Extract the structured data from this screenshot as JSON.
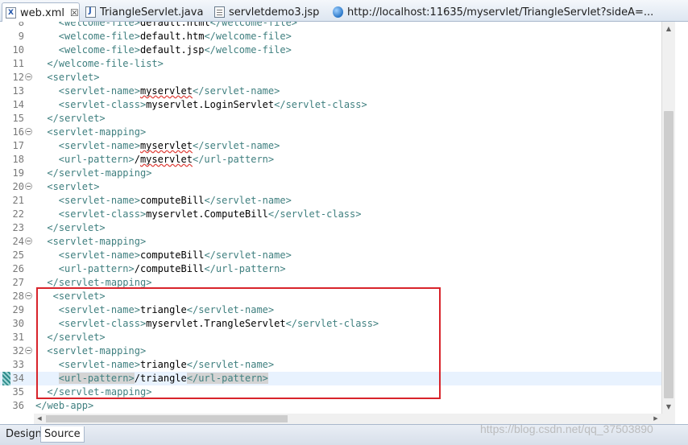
{
  "tabs": [
    {
      "label": "web.xml",
      "icon": "xml-file-icon",
      "active": true,
      "close": "☒"
    },
    {
      "label": "TriangleServlet.java",
      "icon": "java-file-icon",
      "active": false
    },
    {
      "label": "servletdemo3.jsp",
      "icon": "jsp-file-icon",
      "active": false
    },
    {
      "label": "http://localhost:11635/myservlet/TriangleServlet?sideA=...",
      "icon": "globe-icon",
      "active": false
    }
  ],
  "editor": {
    "lines": [
      {
        "n": "8",
        "fold": false,
        "indent": 4,
        "parts": [
          [
            "tag",
            "<welcome-file>"
          ],
          [
            "txt",
            "default.html"
          ],
          [
            "tag",
            "</welcome-file>"
          ]
        ]
      },
      {
        "n": "9",
        "fold": false,
        "indent": 4,
        "parts": [
          [
            "tag",
            "<welcome-file>"
          ],
          [
            "txt",
            "default.htm"
          ],
          [
            "tag",
            "</welcome-file>"
          ]
        ]
      },
      {
        "n": "10",
        "fold": false,
        "indent": 4,
        "parts": [
          [
            "tag",
            "<welcome-file>"
          ],
          [
            "txt",
            "default.jsp"
          ],
          [
            "tag",
            "</welcome-file>"
          ]
        ]
      },
      {
        "n": "11",
        "fold": false,
        "indent": 2,
        "parts": [
          [
            "tag",
            "</welcome-file-list>"
          ]
        ]
      },
      {
        "n": "12",
        "fold": true,
        "indent": 2,
        "parts": [
          [
            "tag",
            "<servlet>"
          ]
        ]
      },
      {
        "n": "13",
        "fold": false,
        "indent": 4,
        "parts": [
          [
            "tag",
            "<servlet-name>"
          ],
          [
            "err",
            "myservlet"
          ],
          [
            "tag",
            "</servlet-name>"
          ]
        ]
      },
      {
        "n": "14",
        "fold": false,
        "indent": 4,
        "parts": [
          [
            "tag",
            "<servlet-class>"
          ],
          [
            "txt",
            "myservlet.LoginServlet"
          ],
          [
            "tag",
            "</servlet-class>"
          ]
        ]
      },
      {
        "n": "15",
        "fold": false,
        "indent": 2,
        "parts": [
          [
            "tag",
            "</servlet>"
          ]
        ]
      },
      {
        "n": "16",
        "fold": true,
        "indent": 2,
        "parts": [
          [
            "tag",
            "<servlet-mapping>"
          ]
        ]
      },
      {
        "n": "17",
        "fold": false,
        "indent": 4,
        "parts": [
          [
            "tag",
            "<servlet-name>"
          ],
          [
            "err",
            "myservlet"
          ],
          [
            "tag",
            "</servlet-name>"
          ]
        ]
      },
      {
        "n": "18",
        "fold": false,
        "indent": 4,
        "parts": [
          [
            "tag",
            "<url-pattern>"
          ],
          [
            "txt",
            "/"
          ],
          [
            "err",
            "myservlet"
          ],
          [
            "tag",
            "</url-pattern>"
          ]
        ]
      },
      {
        "n": "19",
        "fold": false,
        "indent": 2,
        "parts": [
          [
            "tag",
            "</servlet-mapping>"
          ]
        ]
      },
      {
        "n": "20",
        "fold": true,
        "indent": 2,
        "parts": [
          [
            "tag",
            "<servlet>"
          ]
        ]
      },
      {
        "n": "21",
        "fold": false,
        "indent": 4,
        "parts": [
          [
            "tag",
            "<servlet-name>"
          ],
          [
            "txt",
            "computeBill"
          ],
          [
            "tag",
            "</servlet-name>"
          ]
        ]
      },
      {
        "n": "22",
        "fold": false,
        "indent": 4,
        "parts": [
          [
            "tag",
            "<servlet-class>"
          ],
          [
            "txt",
            "myservlet.ComputeBill"
          ],
          [
            "tag",
            "</servlet-class>"
          ]
        ]
      },
      {
        "n": "23",
        "fold": false,
        "indent": 2,
        "parts": [
          [
            "tag",
            "</servlet>"
          ]
        ]
      },
      {
        "n": "24",
        "fold": true,
        "indent": 2,
        "parts": [
          [
            "tag",
            "<servlet-mapping>"
          ]
        ]
      },
      {
        "n": "25",
        "fold": false,
        "indent": 4,
        "parts": [
          [
            "tag",
            "<servlet-name>"
          ],
          [
            "txt",
            "computeBill"
          ],
          [
            "tag",
            "</servlet-name>"
          ]
        ]
      },
      {
        "n": "26",
        "fold": false,
        "indent": 4,
        "parts": [
          [
            "tag",
            "<url-pattern>"
          ],
          [
            "txt",
            "/computeBill"
          ],
          [
            "tag",
            "</url-pattern>"
          ]
        ]
      },
      {
        "n": "27",
        "fold": false,
        "indent": 2,
        "parts": [
          [
            "tag",
            "</servlet-mapping>"
          ]
        ]
      },
      {
        "n": "28",
        "fold": true,
        "indent": 3,
        "parts": [
          [
            "tag",
            "<servlet>"
          ]
        ]
      },
      {
        "n": "29",
        "fold": false,
        "indent": 4,
        "parts": [
          [
            "tag",
            "<servlet-name>"
          ],
          [
            "txt",
            "triangle"
          ],
          [
            "tag",
            "</servlet-name>"
          ]
        ]
      },
      {
        "n": "30",
        "fold": false,
        "indent": 4,
        "parts": [
          [
            "tag",
            "<servlet-class>"
          ],
          [
            "txt",
            "myservlet.TrangleServlet"
          ],
          [
            "tag",
            "</servlet-class>"
          ]
        ]
      },
      {
        "n": "31",
        "fold": false,
        "indent": 2,
        "parts": [
          [
            "tag",
            "</servlet>"
          ]
        ]
      },
      {
        "n": "32",
        "fold": true,
        "indent": 2,
        "parts": [
          [
            "tag",
            "<servlet-mapping>"
          ]
        ]
      },
      {
        "n": "33",
        "fold": false,
        "indent": 4,
        "parts": [
          [
            "tag",
            "<servlet-name>"
          ],
          [
            "txt",
            "triangle"
          ],
          [
            "tag",
            "</servlet-name>"
          ]
        ]
      },
      {
        "n": "34",
        "fold": false,
        "indent": 4,
        "current": true,
        "parts": [
          [
            "tag-hl",
            "<url-pattern>"
          ],
          [
            "txt",
            "/triangle"
          ],
          [
            "tag-hl",
            "</url-pattern>"
          ]
        ]
      },
      {
        "n": "35",
        "fold": false,
        "indent": 2,
        "parts": [
          [
            "tag",
            "</servlet-mapping>"
          ]
        ]
      },
      {
        "n": "36",
        "fold": false,
        "indent": 0,
        "parts": [
          [
            "tag",
            "</web-app>"
          ]
        ]
      }
    ]
  },
  "bottom_tabs": [
    {
      "label": "Design",
      "active": false
    },
    {
      "label": "Source",
      "active": true
    }
  ],
  "watermark": "https://blog.csdn.net/qq_37503890",
  "colors": {
    "tag": "#3f7f7f",
    "text": "#000000",
    "highlight_box": "#d8242b",
    "current_line": "#e8f2fe"
  }
}
